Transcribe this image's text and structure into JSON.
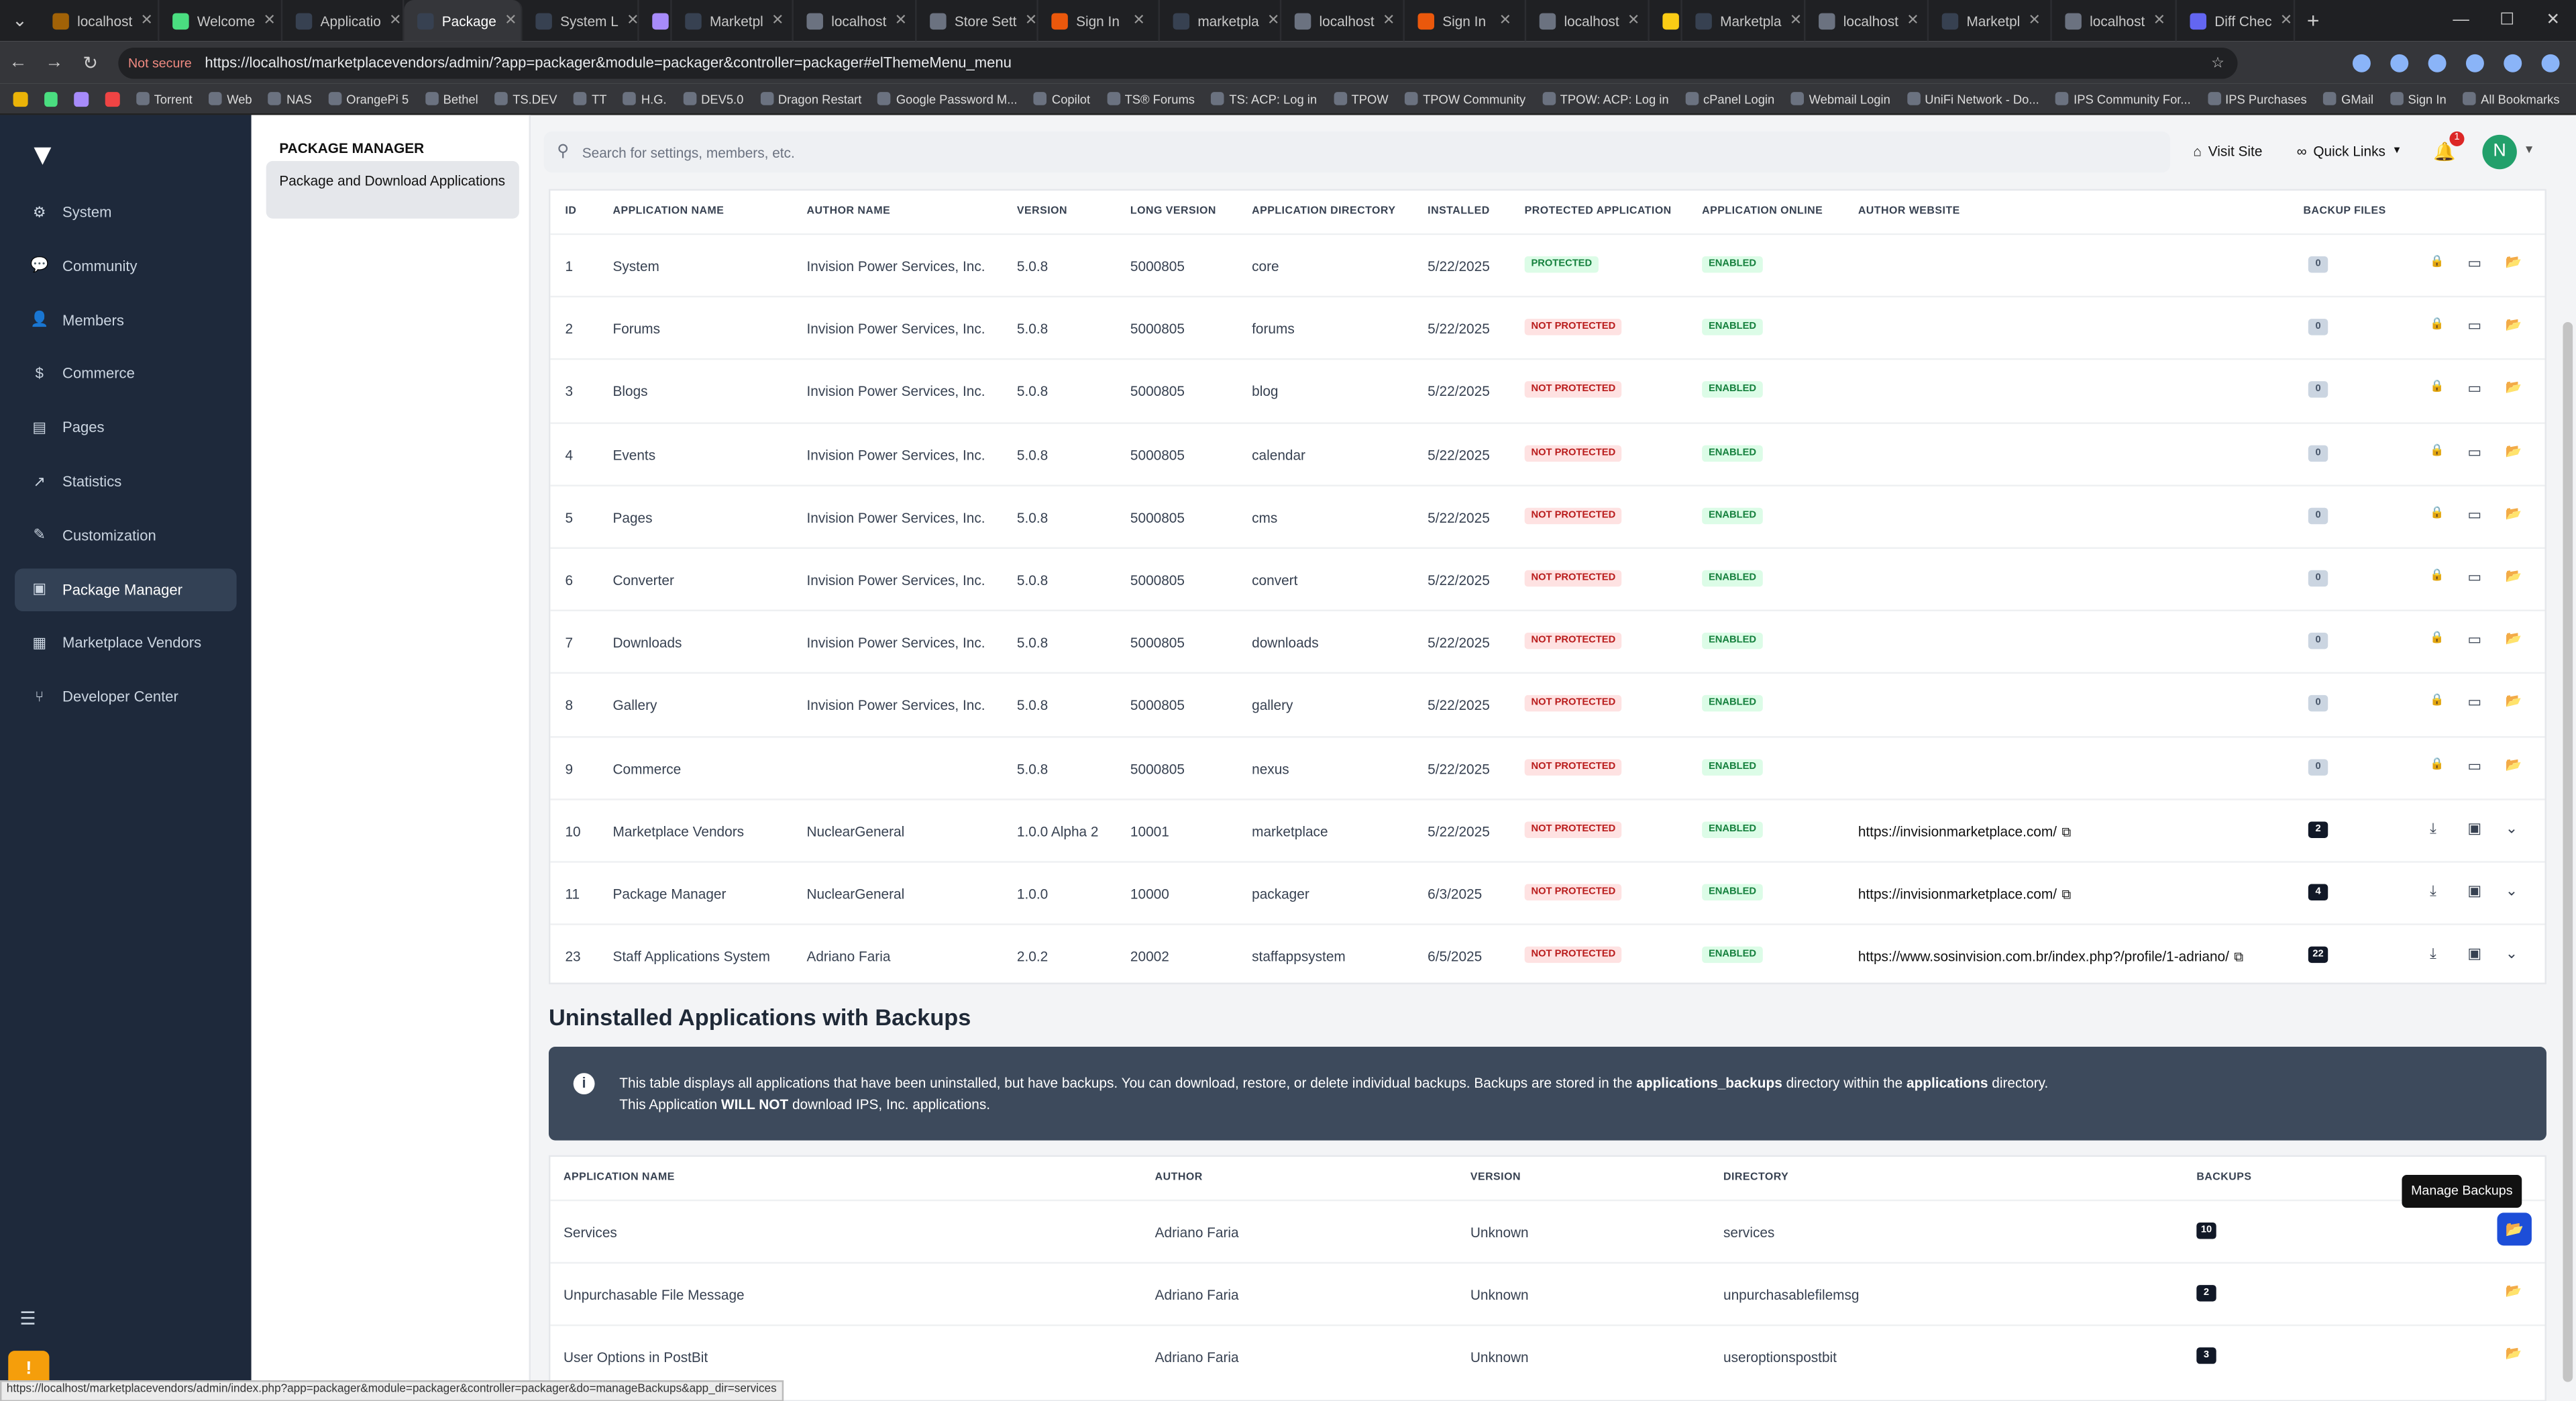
{
  "browser": {
    "tabs": [
      "localhost",
      "Welcome",
      "Applicatio",
      "Package",
      "System L",
      "",
      "Marketpl",
      "localhost",
      "Store Sett",
      "Sign In",
      "marketpla",
      "localhost",
      "Sign In",
      "localhost",
      "",
      "Marketpla",
      "localhost",
      "Marketpl",
      "localhost",
      "Diff Chec"
    ],
    "url": "https://localhost/marketplacevendors/admin/?app=packager&module=packager&controller=packager#elThemeMenu_menu",
    "not_secure": "Not secure",
    "bookmarks": [
      "Torrent",
      "Web",
      "NAS",
      "OrangePi 5",
      "Bethel",
      "TS.DEV",
      "TT",
      "H.G.",
      "DEV5.0",
      "Dragon Restart",
      "Google Password M...",
      "Copilot",
      "TS® Forums",
      "TS: ACP: Log in",
      "TPOW",
      "TPOW Community",
      "TPOW: ACP: Log in",
      "cPanel Login",
      "Webmail Login",
      "UniFi Network - Do...",
      "IPS Community For...",
      "IPS Purchases",
      "GMail",
      "Sign In",
      "All Bookmarks"
    ],
    "status_url": "https://localhost/marketplacevendors/admin/index.php?app=packager&module=packager&controller=packager&do=manageBackups&app_dir=services"
  },
  "sidebar": {
    "items": [
      {
        "label": "System",
        "icon": "gears-icon"
      },
      {
        "label": "Community",
        "icon": "comments-icon"
      },
      {
        "label": "Members",
        "icon": "user-icon"
      },
      {
        "label": "Commerce",
        "icon": "dollar-icon"
      },
      {
        "label": "Pages",
        "icon": "file-icon"
      },
      {
        "label": "Statistics",
        "icon": "chart-icon"
      },
      {
        "label": "Customization",
        "icon": "brush-icon"
      },
      {
        "label": "Package Manager",
        "icon": "box-icon"
      },
      {
        "label": "Marketplace Vendors",
        "icon": "store-icon"
      },
      {
        "label": "Developer Center",
        "icon": "code-branch-icon"
      }
    ]
  },
  "subnav": {
    "title": "PACKAGE MANAGER",
    "item": "Package and Download Applications"
  },
  "header": {
    "search_placeholder": "Search for settings, members, etc.",
    "visit_site": "Visit Site",
    "quick_links": "Quick Links",
    "notif_count": "1",
    "avatar_letter": "N"
  },
  "apps_table": {
    "columns": [
      "ID",
      "APPLICATION NAME",
      "AUTHOR NAME",
      "VERSION",
      "LONG VERSION",
      "APPLICATION DIRECTORY",
      "INSTALLED",
      "PROTECTED APPLICATION",
      "APPLICATION ONLINE",
      "AUTHOR WEBSITE",
      "BACKUP FILES"
    ],
    "rows": [
      {
        "id": "1",
        "name": "System",
        "author": "Invision Power Services, Inc.",
        "version": "5.0.8",
        "long": "5000805",
        "dir": "core",
        "installed": "5/22/2025",
        "protected": "PROTECTED",
        "online": "ENABLED",
        "website": "",
        "backups": "0"
      },
      {
        "id": "2",
        "name": "Forums",
        "author": "Invision Power Services, Inc.",
        "version": "5.0.8",
        "long": "5000805",
        "dir": "forums",
        "installed": "5/22/2025",
        "protected": "NOT PROTECTED",
        "online": "ENABLED",
        "website": "",
        "backups": "0"
      },
      {
        "id": "3",
        "name": "Blogs",
        "author": "Invision Power Services, Inc.",
        "version": "5.0.8",
        "long": "5000805",
        "dir": "blog",
        "installed": "5/22/2025",
        "protected": "NOT PROTECTED",
        "online": "ENABLED",
        "website": "",
        "backups": "0"
      },
      {
        "id": "4",
        "name": "Events",
        "author": "Invision Power Services, Inc.",
        "version": "5.0.8",
        "long": "5000805",
        "dir": "calendar",
        "installed": "5/22/2025",
        "protected": "NOT PROTECTED",
        "online": "ENABLED",
        "website": "",
        "backups": "0"
      },
      {
        "id": "5",
        "name": "Pages",
        "author": "Invision Power Services, Inc.",
        "version": "5.0.8",
        "long": "5000805",
        "dir": "cms",
        "installed": "5/22/2025",
        "protected": "NOT PROTECTED",
        "online": "ENABLED",
        "website": "",
        "backups": "0"
      },
      {
        "id": "6",
        "name": "Converter",
        "author": "Invision Power Services, Inc.",
        "version": "5.0.8",
        "long": "5000805",
        "dir": "convert",
        "installed": "5/22/2025",
        "protected": "NOT PROTECTED",
        "online": "ENABLED",
        "website": "",
        "backups": "0"
      },
      {
        "id": "7",
        "name": "Downloads",
        "author": "Invision Power Services, Inc.",
        "version": "5.0.8",
        "long": "5000805",
        "dir": "downloads",
        "installed": "5/22/2025",
        "protected": "NOT PROTECTED",
        "online": "ENABLED",
        "website": "",
        "backups": "0"
      },
      {
        "id": "8",
        "name": "Gallery",
        "author": "Invision Power Services, Inc.",
        "version": "5.0.8",
        "long": "5000805",
        "dir": "gallery",
        "installed": "5/22/2025",
        "protected": "NOT PROTECTED",
        "online": "ENABLED",
        "website": "",
        "backups": "0"
      },
      {
        "id": "9",
        "name": "Commerce",
        "author": "",
        "version": "5.0.8",
        "long": "5000805",
        "dir": "nexus",
        "installed": "5/22/2025",
        "protected": "NOT PROTECTED",
        "online": "ENABLED",
        "website": "",
        "backups": "0"
      },
      {
        "id": "10",
        "name": "Marketplace Vendors",
        "author": "NuclearGeneral",
        "version": "1.0.0 Alpha 2",
        "long": "10001",
        "dir": "marketplace",
        "installed": "5/22/2025",
        "protected": "NOT PROTECTED",
        "online": "ENABLED",
        "website": "https://invisionmarketplace.com/",
        "backups": "2"
      },
      {
        "id": "11",
        "name": "Package Manager",
        "author": "NuclearGeneral",
        "version": "1.0.0",
        "long": "10000",
        "dir": "packager",
        "installed": "6/3/2025",
        "protected": "NOT PROTECTED",
        "online": "ENABLED",
        "website": "https://invisionmarketplace.com/",
        "backups": "4"
      },
      {
        "id": "23",
        "name": "Staff Applications System",
        "author": "Adriano Faria",
        "version": "2.0.2",
        "long": "20002",
        "dir": "staffappsystem",
        "installed": "6/5/2025",
        "protected": "NOT PROTECTED",
        "online": "ENABLED",
        "website": "https://www.sosinvision.com.br/index.php?/profile/1-adriano/",
        "backups": "22"
      }
    ]
  },
  "uninstalled": {
    "title": "Uninstalled Applications with Backups",
    "info_line1_a": "This table displays all applications that have been uninstalled, but have backups. You can download, restore, or delete individual backups. Backups are stored in the",
    "info_bold1": "applications_backups",
    "info_line1_b": "directory within the",
    "info_bold2": "applications",
    "info_line1_c": "directory.",
    "info_line2_a": "This Application",
    "info_line2_bold": "WILL NOT",
    "info_line2_b": "download IPS, Inc. applications.",
    "columns": [
      "APPLICATION NAME",
      "AUTHOR",
      "VERSION",
      "DIRECTORY",
      "BACKUPS"
    ],
    "rows": [
      {
        "name": "Services",
        "author": "Adriano Faria",
        "version": "Unknown",
        "dir": "services",
        "backups": "10"
      },
      {
        "name": "Unpurchasable File Message",
        "author": "Adriano Faria",
        "version": "Unknown",
        "dir": "unpurchasablefilemsg",
        "backups": "2"
      },
      {
        "name": "User Options in PostBit",
        "author": "Adriano Faria",
        "version": "Unknown",
        "dir": "useroptionspostbit",
        "backups": "3"
      }
    ],
    "tooltip": "Manage Backups"
  },
  "colors": {
    "sidebar": "#1e293b",
    "accent": "#1d4ed8",
    "protected_bg": "#dcfce7",
    "not_protected_bg": "#fee2e2"
  }
}
